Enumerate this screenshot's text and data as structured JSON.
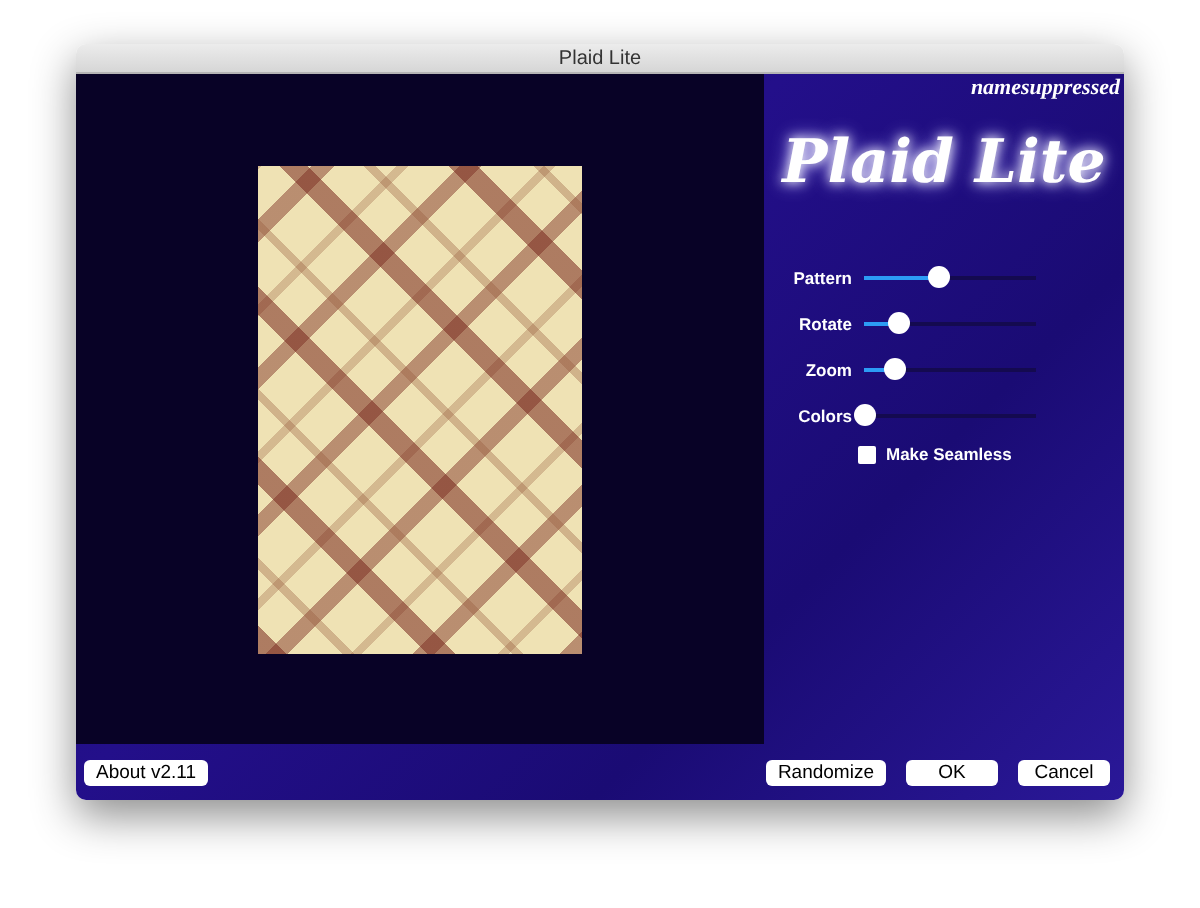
{
  "window": {
    "title": "Plaid Lite"
  },
  "watermark_text": "namesuppressed",
  "logo": "Plaid Lite",
  "sliders": [
    {
      "label": "Pattern",
      "level": 0.43
    },
    {
      "label": "Rotate",
      "level": 0.2
    },
    {
      "label": "Zoom",
      "level": 0.17
    },
    {
      "label": "Colors",
      "level": 0.0
    }
  ],
  "seamless": {
    "label": "Make Seamless",
    "checked": false
  },
  "buttons_left": [
    "About v2.11"
  ],
  "buttons_right": [
    "Randomize",
    "OK",
    "Cancel"
  ]
}
